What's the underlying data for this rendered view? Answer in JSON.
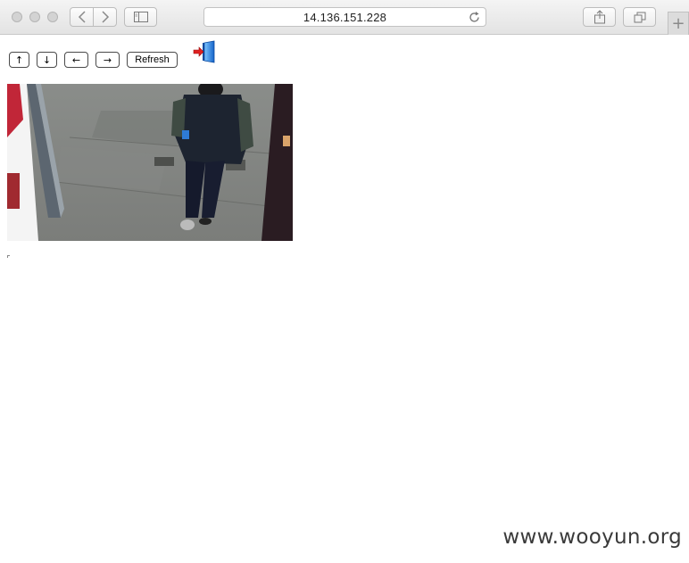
{
  "browser": {
    "address_url": "14.136.151.228",
    "new_tab_glyph": "+",
    "icons": [
      "back-chevron-icon",
      "forward-chevron-icon",
      "sidebar-icon",
      "reload-icon",
      "share-icon",
      "tabs-overview-icon"
    ]
  },
  "controls": {
    "up_label": "↑",
    "down_label": "↓",
    "left_label": "←",
    "right_label": "→",
    "refresh_label": "Refresh",
    "exit_icon": "exit-door-icon"
  },
  "camera": {
    "feed_icon": "camera-snapshot"
  },
  "watermark": {
    "text": "www.wooyun.org"
  }
}
